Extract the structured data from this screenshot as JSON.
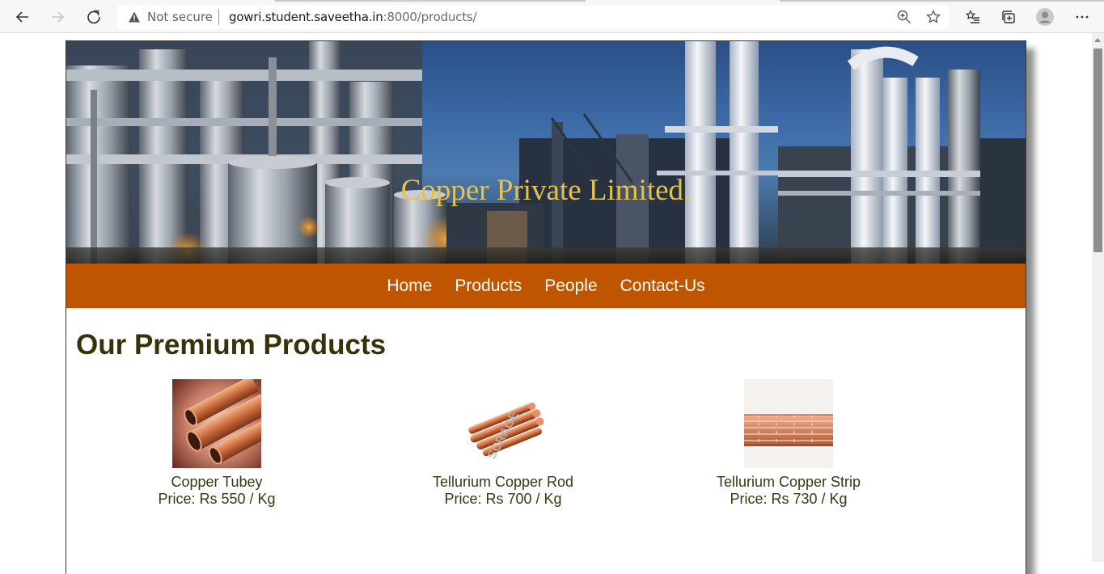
{
  "browser": {
    "security_label": "Not secure",
    "url_host": "gowri.student.saveetha.in",
    "url_path": ":8000/products/",
    "icons": [
      "back-icon",
      "forward-icon",
      "reload-icon",
      "warning-icon",
      "zoom-icon",
      "favorite-star-icon",
      "favorites-list-icon",
      "collections-icon",
      "profile-avatar-icon",
      "more-icon"
    ]
  },
  "site": {
    "title": "Copper Private Limited.",
    "title_color": "#e5c24a",
    "nav_color": "#c05500",
    "nav": [
      "Home",
      "Products",
      "People",
      "Contact-Us"
    ]
  },
  "main": {
    "heading": "Our Premium Products",
    "products": [
      {
        "name": "Copper Tubey",
        "price": "Price: Rs 550 / Kg"
      },
      {
        "name": "Tellurium Copper Rod",
        "price": "Price: Rs 700 / Kg",
        "watermark": "SCRAGE"
      },
      {
        "name": "Tellurium Copper Strip",
        "price": "Price: Rs 730 / Kg"
      }
    ]
  }
}
